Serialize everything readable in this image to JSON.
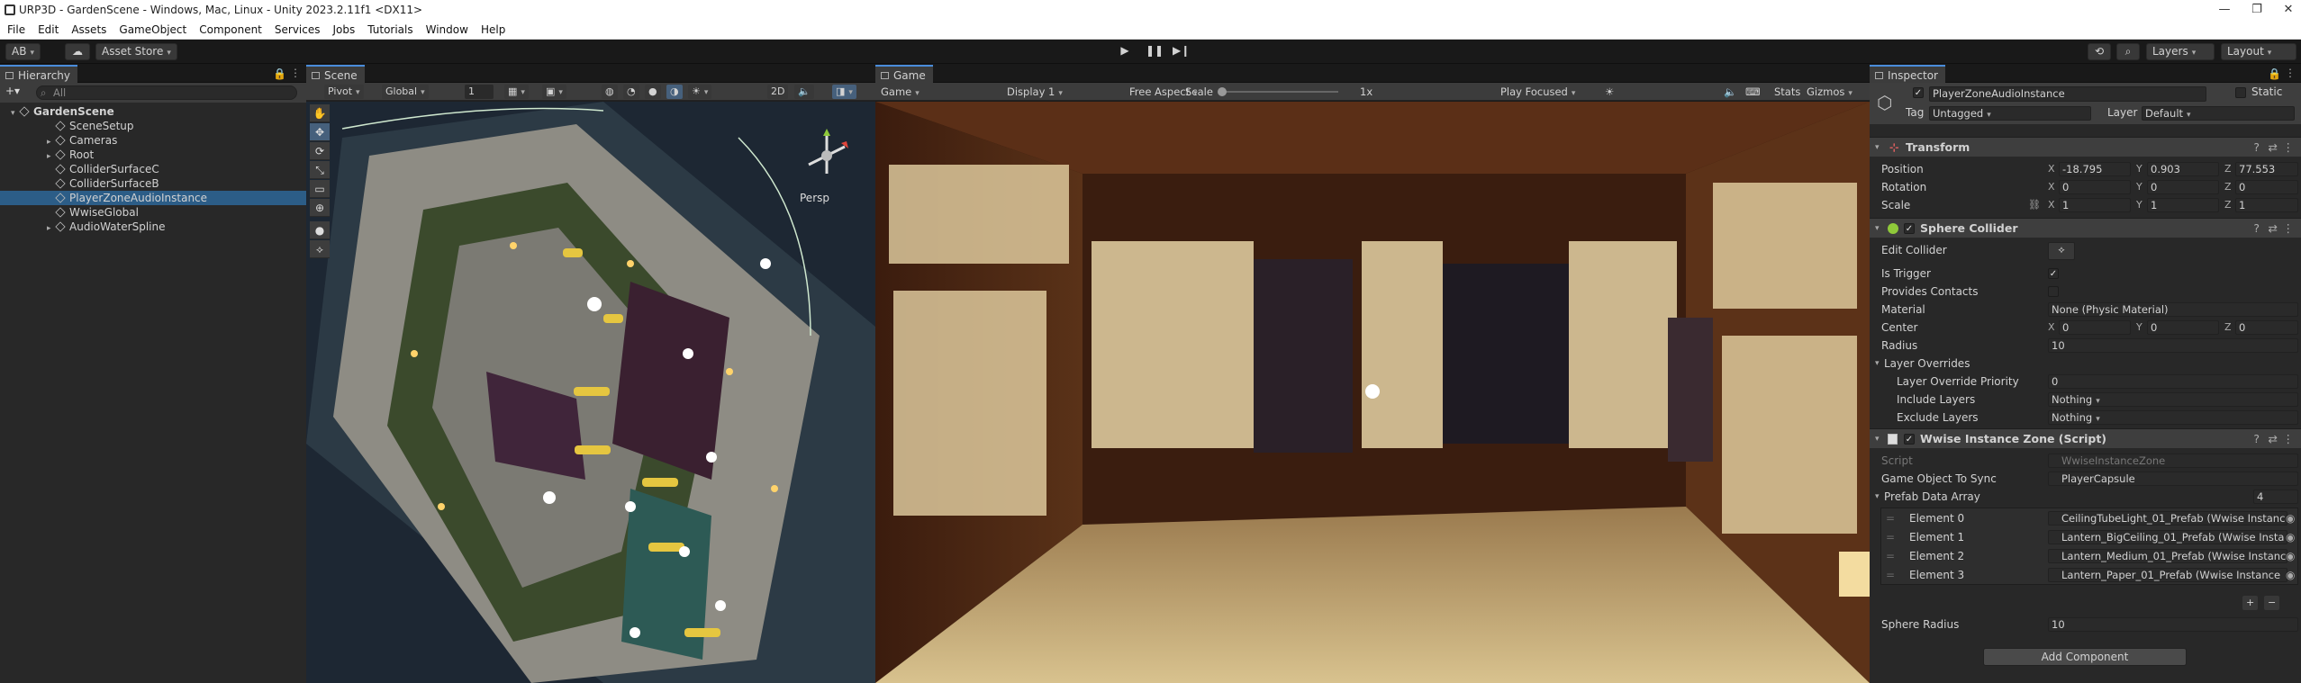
{
  "window": {
    "title": "URP3D - GardenScene - Windows, Mac, Linux - Unity 2023.2.11f1 <DX11>",
    "min": "—",
    "max": "❐",
    "close": "✕"
  },
  "menu": [
    "File",
    "Edit",
    "Assets",
    "GameObject",
    "Component",
    "Services",
    "Jobs",
    "Tutorials",
    "Window",
    "Help"
  ],
  "toolbar": {
    "account": "AB",
    "asset_store": "Asset Store",
    "layers": "Layers",
    "layout": "Layout"
  },
  "hierarchy": {
    "tab": "Hierarchy",
    "search_placeholder": "All",
    "items": [
      {
        "label": "GardenScene",
        "depth": 0,
        "fold": "▾",
        "type": "scene"
      },
      {
        "label": "SceneSetup",
        "depth": 1,
        "fold": ""
      },
      {
        "label": "Cameras",
        "depth": 1,
        "fold": "▸"
      },
      {
        "label": "Root",
        "depth": 1,
        "fold": "▸"
      },
      {
        "label": "ColliderSurfaceC",
        "depth": 1,
        "fold": ""
      },
      {
        "label": "ColliderSurfaceB",
        "depth": 1,
        "fold": ""
      },
      {
        "label": "PlayerZoneAudioInstance",
        "depth": 1,
        "fold": "",
        "selected": true
      },
      {
        "label": "WwiseGlobal",
        "depth": 1,
        "fold": ""
      },
      {
        "label": "AudioWaterSpline",
        "depth": 1,
        "fold": "▸"
      }
    ]
  },
  "scene": {
    "tab": "Scene",
    "pivot": "Pivot",
    "global": "Global",
    "grid_value": "1",
    "mode_2d": "2D",
    "persp": "Persp"
  },
  "game": {
    "tab": "Game",
    "mode": "Game",
    "display": "Display 1",
    "aspect": "Free Aspect",
    "scale_label": "Scale",
    "scale_value": "1x",
    "play_focused": "Play Focused",
    "stats": "Stats",
    "gizmos": "Gizmos"
  },
  "inspector": {
    "tab": "Inspector",
    "object_name": "PlayerZoneAudioInstance",
    "static": "Static",
    "tag_label": "Tag",
    "tag": "Untagged",
    "layer_label": "Layer",
    "layer": "Default",
    "transform": {
      "title": "Transform",
      "position": {
        "label": "Position",
        "x": "-18.795",
        "y": "0.903",
        "z": "77.553"
      },
      "rotation": {
        "label": "Rotation",
        "x": "0",
        "y": "0",
        "z": "0"
      },
      "scale": {
        "label": "Scale",
        "x": "1",
        "y": "1",
        "z": "1"
      }
    },
    "sphere": {
      "title": "Sphere Collider",
      "edit_collider": "Edit Collider",
      "is_trigger": "Is Trigger",
      "provides_contacts": "Provides Contacts",
      "material_label": "Material",
      "material": "None (Physic Material)",
      "center_label": "Center",
      "cx": "0",
      "cy": "0",
      "cz": "0",
      "radius_label": "Radius",
      "radius": "10",
      "layer_overrides": "Layer Overrides",
      "priority_label": "Layer Override Priority",
      "priority": "0",
      "include_label": "Include Layers",
      "include": "Nothing",
      "exclude_label": "Exclude Layers",
      "exclude": "Nothing"
    },
    "wwise": {
      "title": "Wwise Instance Zone (Script)",
      "script_label": "Script",
      "script": "WwiseInstanceZone",
      "sync_label": "Game Object To Sync",
      "sync": "PlayerCapsule",
      "array_label": "Prefab Data Array",
      "array_count": "4",
      "elements": [
        {
          "label": "Element 0",
          "value": "CeilingTubeLight_01_Prefab (Wwise Instanc"
        },
        {
          "label": "Element 1",
          "value": "Lantern_BigCeiling_01_Prefab (Wwise Insta"
        },
        {
          "label": "Element 2",
          "value": "Lantern_Medium_01_Prefab (Wwise Instanc"
        },
        {
          "label": "Element 3",
          "value": "Lantern_Paper_01_Prefab (Wwise Instance"
        }
      ],
      "sphere_radius_label": "Sphere Radius",
      "sphere_radius": "10"
    },
    "add_component": "Add Component"
  },
  "colors": {
    "selection": "#2c5d87",
    "accent": "#4a8cdb",
    "panel": "#282828",
    "header": "#3e3e3e"
  }
}
